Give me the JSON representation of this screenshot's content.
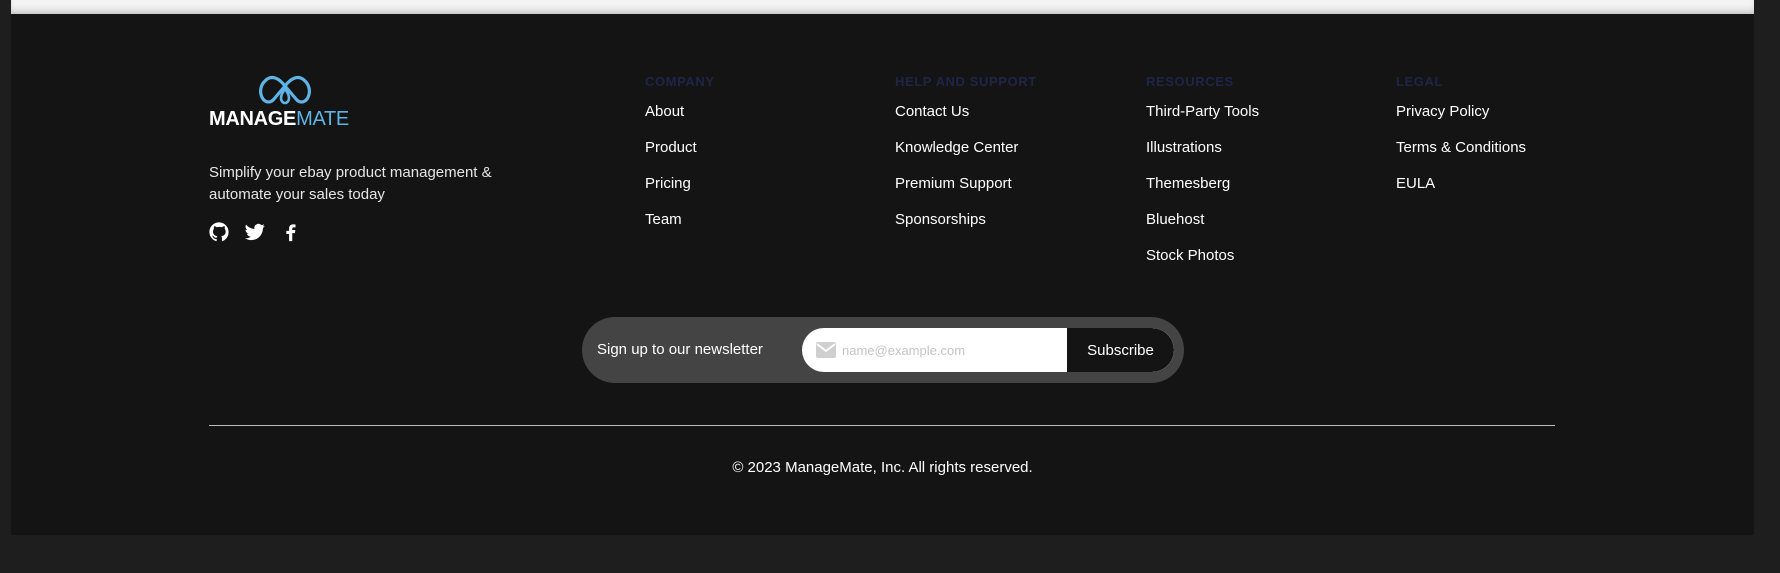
{
  "brand": {
    "name_part1": "MANAGE",
    "name_part2": "MATE",
    "tagline": "Simplify your ebay product management & automate your sales today",
    "logo_icon": "double-m-drop-icon",
    "accent_color": "#5fb4e6"
  },
  "social": [
    {
      "icon": "github-icon",
      "label": "GitHub"
    },
    {
      "icon": "twitter-icon",
      "label": "Twitter"
    },
    {
      "icon": "facebook-icon",
      "label": "Facebook"
    }
  ],
  "columns": [
    {
      "heading": "Company",
      "links": [
        "About",
        "Product",
        "Pricing",
        "Team"
      ]
    },
    {
      "heading": "Help and Support",
      "links": [
        "Contact Us",
        "Knowledge Center",
        "Premium Support",
        "Sponsorships"
      ]
    },
    {
      "heading": "Resources",
      "links": [
        "Third-Party Tools",
        "Illustrations",
        "Themesberg",
        "Bluehost",
        "Stock Photos"
      ]
    },
    {
      "heading": "Legal",
      "links": [
        "Privacy Policy",
        "Terms & Conditions",
        "EULA"
      ]
    }
  ],
  "newsletter": {
    "label": "Sign up to our newsletter",
    "placeholder": "name@example.com",
    "value": "",
    "button_label": "Subscribe",
    "icon": "mail-icon"
  },
  "copyright": "© 2023 ManageMate, Inc. All rights reserved.",
  "colors": {
    "footer_bg": "#141414",
    "page_bg": "#1e1e1e",
    "newsletter_bg": "#444444",
    "heading_color": "#1f2547"
  }
}
